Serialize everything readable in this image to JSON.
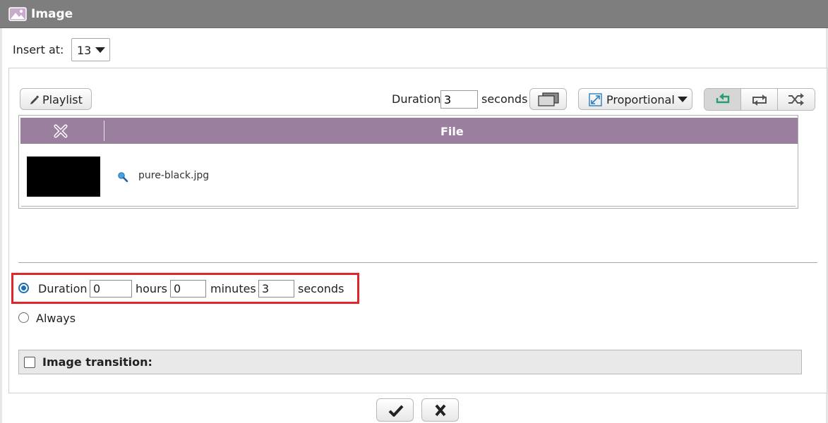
{
  "dialog": {
    "title": "Image",
    "title_icon": "image-icon"
  },
  "insert": {
    "label": "Insert at:",
    "selected": "13"
  },
  "toolbar": {
    "playlist_label": "Playlist",
    "duration_label": "Duration",
    "duration_value": "3",
    "seconds_label": "seconds",
    "scale_label": "Proportional",
    "loop_modes": [
      "loop-icon",
      "repeat-icon",
      "shuffle-icon"
    ],
    "active_loop_mode": "loop-icon"
  },
  "table": {
    "header_file": "File",
    "rows": [
      {
        "filename": "pure-black.jpg"
      }
    ]
  },
  "duration_form": {
    "label": "Duration",
    "hours": "0",
    "hours_label": "hours",
    "minutes": "0",
    "minutes_label": "minutes",
    "seconds": "3",
    "seconds_label": "seconds",
    "always_label": "Always",
    "selected": "duration"
  },
  "transition": {
    "label": "Image transition:",
    "checked": false
  },
  "colors": {
    "titlebar": "#7e7e7e",
    "table_header": "#9b7f9e",
    "highlight": "#e0262b",
    "active_loop_icon": "#2a9d6e"
  }
}
